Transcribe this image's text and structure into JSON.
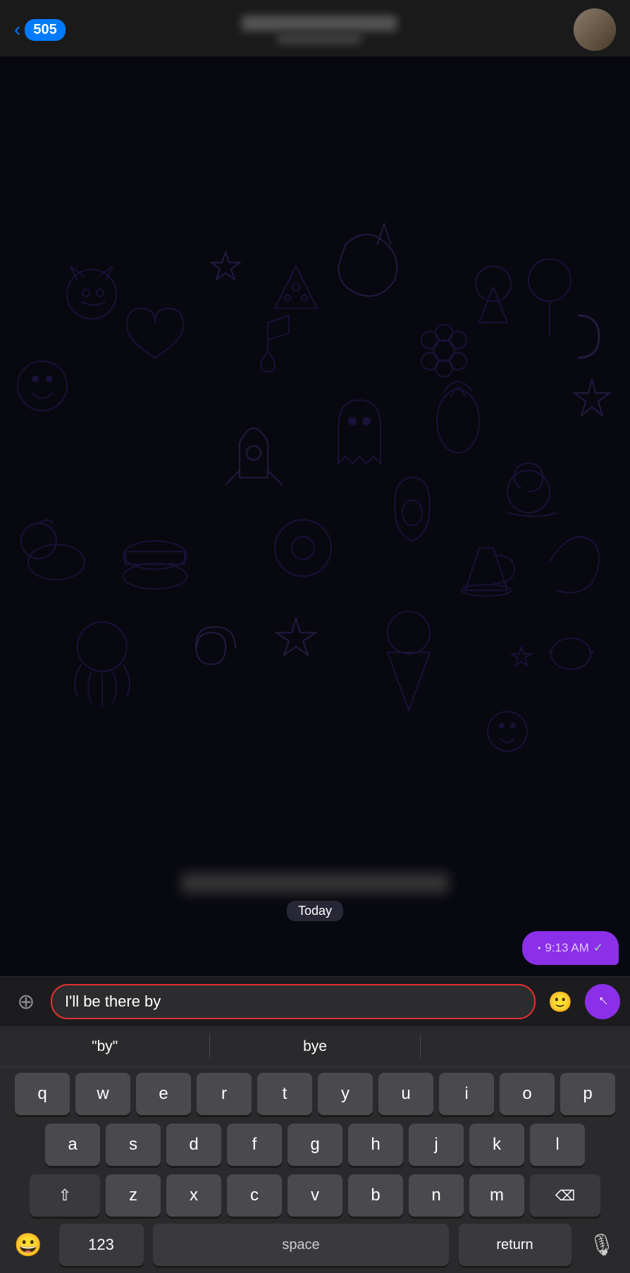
{
  "header": {
    "back_label": "505",
    "contact_name_blurred": true,
    "avatar_blurred": false
  },
  "chat": {
    "date_label": "Today",
    "messages": [
      {
        "type": "sent",
        "time": "9:13 AM",
        "read": true
      }
    ]
  },
  "input": {
    "text_value": "I'll be there by",
    "attach_icon": "📎",
    "emoji_icon": "🙂",
    "send_icon": "↑"
  },
  "autocomplete": {
    "suggestions": [
      "\"by\"",
      "bye",
      ""
    ]
  },
  "keyboard": {
    "rows": [
      [
        "q",
        "w",
        "e",
        "r",
        "t",
        "y",
        "u",
        "i",
        "o",
        "p"
      ],
      [
        "a",
        "s",
        "d",
        "f",
        "g",
        "h",
        "j",
        "k",
        "l"
      ],
      [
        "z",
        "x",
        "c",
        "v",
        "b",
        "n",
        "m"
      ]
    ],
    "shift_label": "⇧",
    "delete_label": "⌫",
    "numbers_label": "123",
    "space_label": "space",
    "return_label": "return",
    "emoji_label": "😀",
    "mic_label": "🎤"
  }
}
